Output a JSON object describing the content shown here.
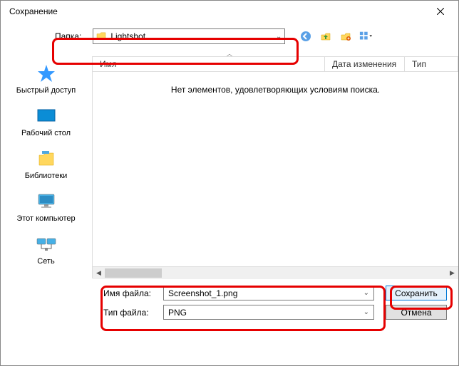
{
  "title": "Сохранение",
  "toolbar": {
    "folder_label": "Папка:",
    "folder_name": "Lightshot"
  },
  "sidebar": {
    "items": [
      {
        "label": "Быстрый доступ"
      },
      {
        "label": "Рабочий стол"
      },
      {
        "label": "Библиотеки"
      },
      {
        "label": "Этот компьютер"
      },
      {
        "label": "Сеть"
      }
    ]
  },
  "columns": {
    "name": "Имя",
    "date": "Дата изменения",
    "type": "Тип"
  },
  "empty_message": "Нет элементов, удовлетворяющих условиям поиска.",
  "fields": {
    "filename_label": "Имя файла:",
    "filename_value": "Screenshot_1.png",
    "filetype_label": "Тип файла:",
    "filetype_value": "PNG"
  },
  "buttons": {
    "save": "Сохранить",
    "cancel": "Отмена"
  }
}
